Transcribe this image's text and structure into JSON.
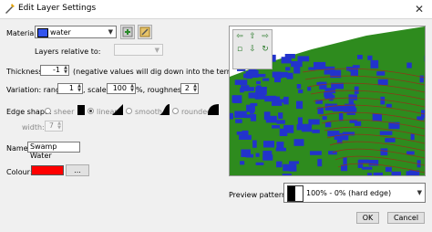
{
  "window": {
    "title": "Edit Layer Settings",
    "close": "✕"
  },
  "material": {
    "label": "Material:",
    "value": "water",
    "swatch": "#3355ee"
  },
  "layers_relative": {
    "label": "Layers relative to:"
  },
  "thickness": {
    "label": "Thickness:",
    "value": "-1",
    "note": "(negative values will dig down into the terrain)"
  },
  "variation": {
    "label": "Variation: range:",
    "range": "1",
    "scale_label": ", scale:",
    "scale": "100",
    "pct_label": "%, roughness:",
    "roughness": "2"
  },
  "edge_shape": {
    "label": "Edge shape:",
    "options": [
      "sheer",
      "linear",
      "smooth",
      "rounded"
    ],
    "selected": "linear"
  },
  "width": {
    "label": "width:",
    "value": "7"
  },
  "name": {
    "label": "Name:",
    "value": "Swamp Water"
  },
  "colour": {
    "label": "Colour:",
    "value": "#ff0000",
    "button": "..."
  },
  "preview_pattern": {
    "label": "Preview pattern:",
    "value": "100% - 0% (hard edge)"
  },
  "buttons": {
    "ok": "OK",
    "cancel": "Cancel"
  },
  "colors": {
    "terrain_green": "#2e8b1e",
    "water_blue": "#2233cc",
    "sky": "#ffffff"
  }
}
